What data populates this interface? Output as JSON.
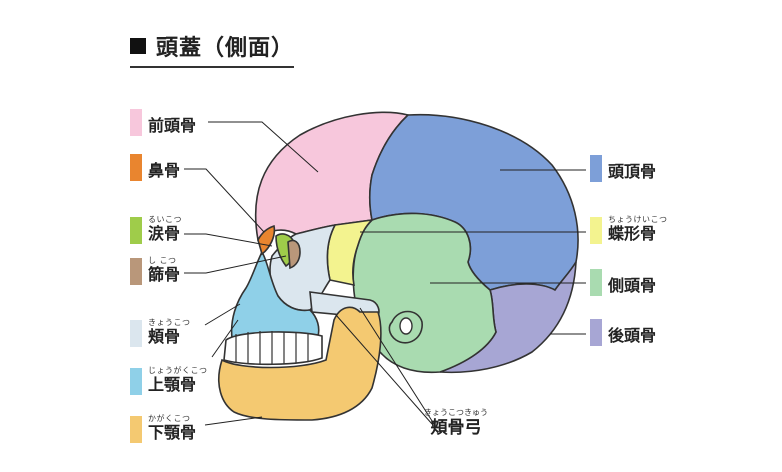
{
  "title": "頭蓋（側面）",
  "labels": {
    "frontal": {
      "ruby": "",
      "text": "前頭骨",
      "color": "#f7c7dc"
    },
    "nasal": {
      "ruby": "",
      "text": "鼻骨",
      "color": "#e9852f"
    },
    "lacrimal": {
      "ruby": "るいこつ",
      "text": "涙骨",
      "color": "#9fcc4a"
    },
    "ethmoid": {
      "ruby": "し こつ",
      "text": "篩骨",
      "color": "#b9977a"
    },
    "zygomatic": {
      "ruby": "きょうこつ",
      "text": "頬骨",
      "color": "#dbe6ee"
    },
    "maxilla": {
      "ruby": "じょうがくこつ",
      "text": "上顎骨",
      "color": "#8fd0e8"
    },
    "mandible": {
      "ruby": "かがくこつ",
      "text": "下顎骨",
      "color": "#f4c971"
    },
    "parietal": {
      "ruby": "",
      "text": "頭頂骨",
      "color": "#7d9fd8"
    },
    "sphenoid": {
      "ruby": "ちょうけいこつ",
      "text": "蝶形骨",
      "color": "#f3f38f"
    },
    "temporal": {
      "ruby": "",
      "text": "側頭骨",
      "color": "#a9dbb0"
    },
    "occipital": {
      "ruby": "",
      "text": "後頭骨",
      "color": "#a7a6d4"
    },
    "zygomatic_arch": {
      "ruby": "きょうこつきゅう",
      "text": "頬骨弓"
    }
  }
}
